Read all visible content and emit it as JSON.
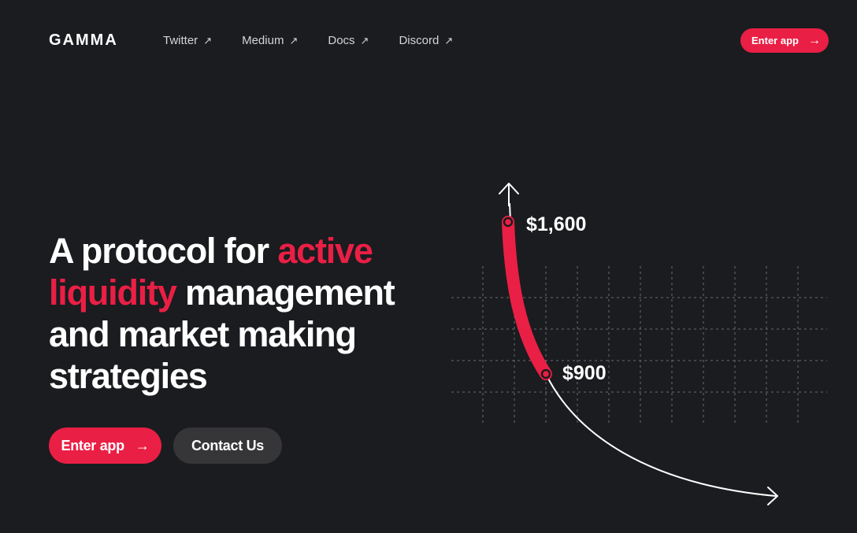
{
  "brand": {
    "logo_text": "GAMMA"
  },
  "nav": {
    "links": [
      {
        "label": "Twitter",
        "icon": "external-arrow-icon"
      },
      {
        "label": "Medium",
        "icon": "external-arrow-icon"
      },
      {
        "label": "Docs",
        "icon": "external-arrow-icon"
      },
      {
        "label": "Discord",
        "icon": "external-arrow-icon"
      }
    ],
    "external_arrow": "↗",
    "cta_label": "Enter app",
    "cta_arrow": "→"
  },
  "hero": {
    "title_part1": "A protocol for ",
    "title_accent1": "active",
    "title_accent2": "liquidity",
    "title_part2": " management and market making strategies",
    "primary_cta": "Enter app",
    "primary_arrow": "→",
    "secondary_cta": "Contact Us"
  },
  "illustration": {
    "upper_price": "$1,600",
    "lower_price": "$900"
  },
  "colors": {
    "background": "#1b1c1f",
    "accent": "#ea1f45",
    "secondary_button": "#363538",
    "text": "#ffffff"
  }
}
